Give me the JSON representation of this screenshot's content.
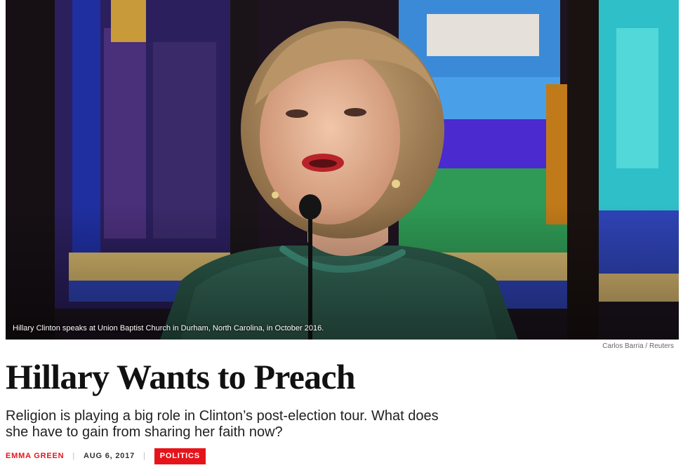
{
  "hero": {
    "caption": "Hillary Clinton speaks at Union Baptist Church in Durham, North Carolina, in October 2016.",
    "credit": "Carlos Barria / Reuters"
  },
  "article": {
    "headline": "Hillary Wants to Preach",
    "dek": "Religion is playing a big role in Clinton’s post-election tour. What does she have to gain from sharing her faith now?",
    "author": "EMMA GREEN",
    "separator": "|",
    "date": "AUG 6, 2017",
    "section": "POLITICS"
  },
  "colors": {
    "accent": "#e7131a",
    "text": "#111111"
  }
}
